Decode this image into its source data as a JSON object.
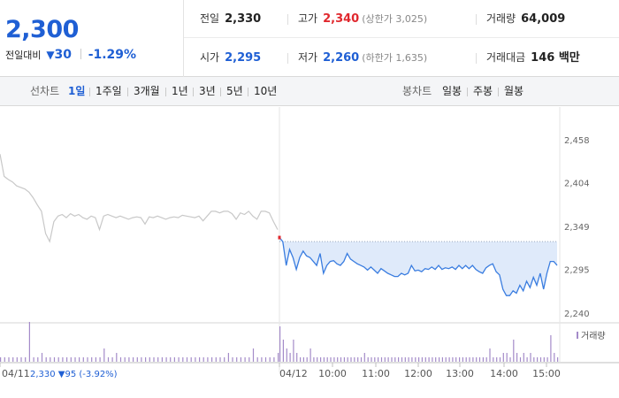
{
  "quote": {
    "price": "2,300",
    "change_label": "전일대비",
    "change_icon": "down-triangle-icon",
    "change_value": "30",
    "change_percent": "-1.29%"
  },
  "stats": {
    "prev_close": {
      "label": "전일",
      "value": "2,330"
    },
    "high": {
      "label": "고가",
      "value": "2,340",
      "note": "(상한가 3,025)"
    },
    "volume": {
      "label": "거래량",
      "value": "64,009"
    },
    "open": {
      "label": "시가",
      "value": "2,295"
    },
    "low": {
      "label": "저가",
      "value": "2,260",
      "note": "(하한가 1,635)"
    },
    "amount": {
      "label": "거래대금",
      "value": "146 백만"
    }
  },
  "toolbar": {
    "line_label": "선차트",
    "line_periods": [
      {
        "label": "1일",
        "active": true
      },
      {
        "label": "1주일",
        "active": false
      },
      {
        "label": "3개월",
        "active": false
      },
      {
        "label": "1년",
        "active": false
      },
      {
        "label": "3년",
        "active": false
      },
      {
        "label": "5년",
        "active": false
      },
      {
        "label": "10년",
        "active": false
      }
    ],
    "candle_label": "봉차트",
    "candle_periods": [
      {
        "label": "일봉"
      },
      {
        "label": "주봉"
      },
      {
        "label": "월봉"
      }
    ]
  },
  "colors": {
    "blue": "#1f5fd4",
    "red": "#e0282e",
    "prev_day_line": "#c8c8c8",
    "today_line": "#3a7de0",
    "today_fill": "#dfeafa",
    "volume": "#a48bc9"
  },
  "chart_data": {
    "type": "line",
    "y_ticks": [
      "2,458",
      "2,404",
      "2,349",
      "2,295",
      "2,240"
    ],
    "ylim": [
      2240,
      2458
    ],
    "x_ticks": [
      "04/11",
      "04/12",
      "10:00",
      "11:00",
      "12:00",
      "13:00",
      "14:00",
      "15:00"
    ],
    "prev_day_info": {
      "date": "04/11",
      "close": "2,330",
      "change": "▼95",
      "percent": "(-3.92%)"
    },
    "prev_close_reference": 2330,
    "volume_legend": "거래량",
    "series": [
      {
        "day": "04/11",
        "values": [
          2440,
          2412,
          2408,
          2405,
          2400,
          2398,
          2396,
          2392,
          2385,
          2376,
          2368,
          2340,
          2330,
          2355,
          2362,
          2364,
          2360,
          2365,
          2362,
          2364,
          2360,
          2358,
          2362,
          2360,
          2345,
          2362,
          2364,
          2362,
          2360,
          2362,
          2360,
          2358,
          2360,
          2361,
          2360,
          2352,
          2361,
          2360,
          2362,
          2360,
          2358,
          2360,
          2361,
          2360,
          2363,
          2362,
          2361,
          2360,
          2362,
          2356,
          2362,
          2368,
          2368,
          2366,
          2368,
          2368,
          2365,
          2358,
          2366,
          2364,
          2368,
          2362,
          2358,
          2368,
          2368,
          2366,
          2355,
          2345
        ]
      },
      {
        "day": "04/12",
        "values": [
          2335,
          2330,
          2300,
          2320,
          2310,
          2295,
          2310,
          2318,
          2312,
          2310,
          2305,
          2300,
          2315,
          2290,
          2300,
          2305,
          2306,
          2302,
          2300,
          2305,
          2315,
          2308,
          2305,
          2302,
          2300,
          2298,
          2294,
          2298,
          2294,
          2290,
          2296,
          2293,
          2290,
          2288,
          2286,
          2286,
          2290,
          2288,
          2290,
          2300,
          2293,
          2294,
          2292,
          2296,
          2295,
          2298,
          2295,
          2300,
          2295,
          2297,
          2296,
          2298,
          2295,
          2300,
          2296,
          2300,
          2296,
          2300,
          2295,
          2292,
          2290,
          2297,
          2300,
          2302,
          2292,
          2288,
          2270,
          2262,
          2262,
          2268,
          2265,
          2275,
          2268,
          2280,
          2272,
          2285,
          2275,
          2290,
          2270,
          2290,
          2305,
          2305,
          2300
        ]
      }
    ],
    "volume": {
      "prev_day": [
        1,
        1,
        1,
        1,
        1,
        1,
        1,
        9,
        1,
        1,
        2,
        1,
        1,
        1,
        1,
        1,
        1,
        1,
        1,
        1,
        1,
        1,
        1,
        1,
        1,
        3,
        1,
        1,
        2,
        1,
        1,
        1,
        1,
        1,
        1,
        1,
        1,
        1,
        1,
        1,
        1,
        1,
        1,
        1,
        1,
        1,
        1,
        1,
        1,
        1,
        1,
        1,
        1,
        1,
        1,
        2,
        1,
        1,
        1,
        1,
        1,
        3,
        1,
        1,
        1,
        1,
        1,
        2
      ],
      "today": [
        8,
        5,
        3,
        2,
        5,
        2,
        1,
        1,
        1,
        3,
        1,
        1,
        1,
        1,
        1,
        1,
        1,
        1,
        1,
        1,
        1,
        1,
        1,
        1,
        1,
        2,
        1,
        1,
        1,
        1,
        1,
        1,
        1,
        1,
        1,
        1,
        1,
        1,
        1,
        1,
        1,
        1,
        1,
        1,
        1,
        1,
        1,
        1,
        1,
        1,
        1,
        1,
        1,
        1,
        1,
        1,
        1,
        1,
        1,
        1,
        1,
        1,
        3,
        1,
        1,
        1,
        2,
        2,
        1,
        5,
        2,
        1,
        2,
        1,
        2,
        1,
        1,
        1,
        1,
        1,
        6,
        2,
        1
      ]
    }
  }
}
